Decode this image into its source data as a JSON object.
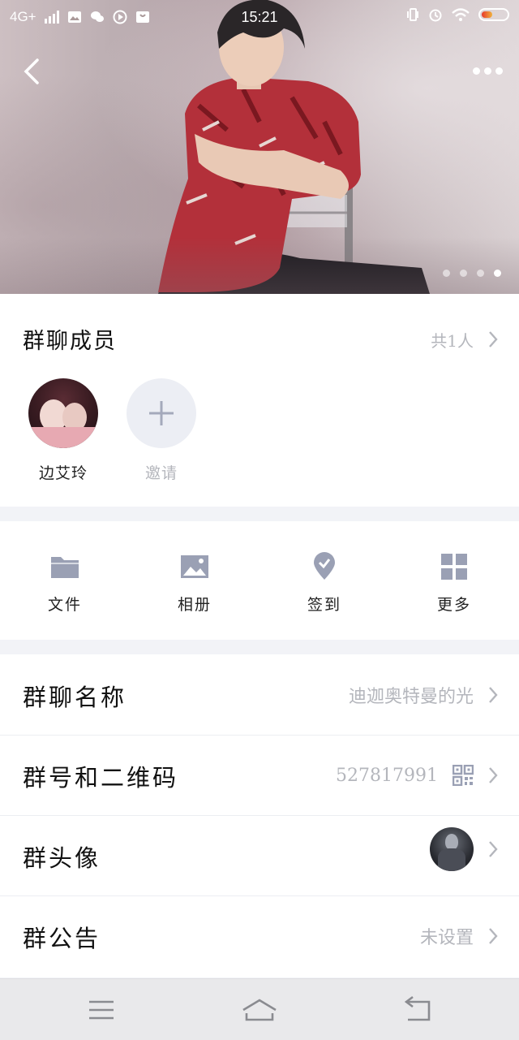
{
  "status_bar": {
    "network": "4G+",
    "time": "15:21",
    "battery_color": "#e8382c"
  },
  "hero": {
    "carousel_total": 4,
    "carousel_active": 4,
    "back_icon": "chevron-left-icon",
    "more_icon": "more-dots-icon"
  },
  "members": {
    "title": "群聊成员",
    "count_text": "共1人",
    "items": [
      {
        "name": "边艾玲"
      },
      {
        "name": "邀请"
      }
    ]
  },
  "actions": [
    {
      "label": "文件",
      "icon": "folder-icon"
    },
    {
      "label": "相册",
      "icon": "image-icon"
    },
    {
      "label": "签到",
      "icon": "checkin-pin-icon"
    },
    {
      "label": "更多",
      "icon": "grid-icon"
    }
  ],
  "settings": {
    "group_name": {
      "label": "群聊名称",
      "value": "迪迦奥特曼的光"
    },
    "group_number": {
      "label": "群号和二维码",
      "value": "527817991"
    },
    "group_avatar": {
      "label": "群头像"
    },
    "group_notice": {
      "label": "群公告",
      "value": "未设置"
    }
  },
  "colors": {
    "muted_text": "#b4b6bc",
    "icon_gray": "#9aa0b4",
    "divider": "#f2f3f7"
  }
}
